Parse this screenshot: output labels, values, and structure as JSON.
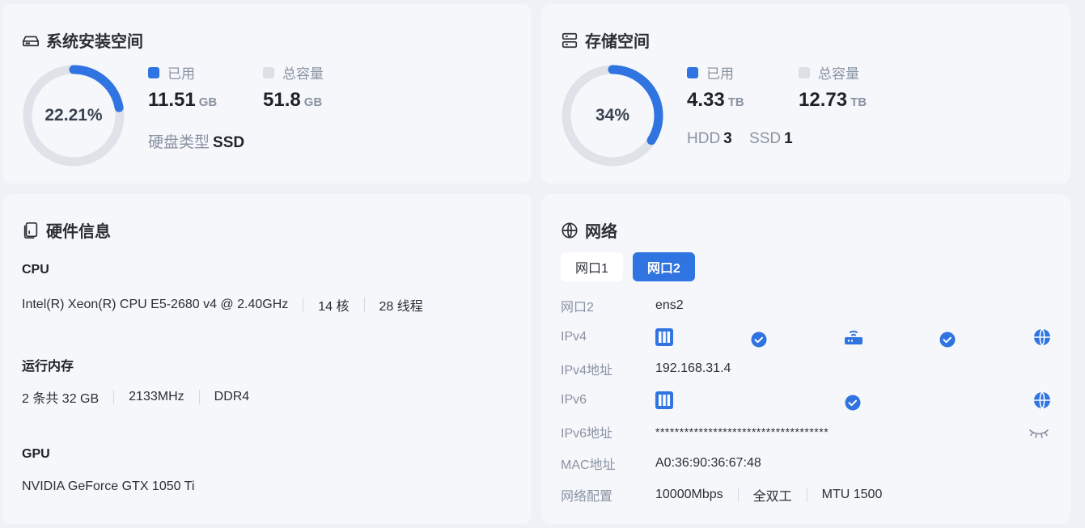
{
  "system_disk": {
    "title": "系统安装空间",
    "percent": 22.21,
    "percent_label": "22.21%",
    "used_label": "已用",
    "used_value": "11.51",
    "used_unit": "GB",
    "total_label": "总容量",
    "total_value": "51.8",
    "total_unit": "GB",
    "disk_type_label": "硬盘类型",
    "disk_type_value": "SSD"
  },
  "storage": {
    "title": "存储空间",
    "percent": 34,
    "percent_label": "34%",
    "used_label": "已用",
    "used_value": "4.33",
    "used_unit": "TB",
    "total_label": "总容量",
    "total_value": "12.73",
    "total_unit": "TB",
    "hdd_label": "HDD",
    "hdd_count": "3",
    "ssd_label": "SSD",
    "ssd_count": "1"
  },
  "hardware": {
    "title": "硬件信息",
    "cpu": {
      "label": "CPU",
      "model": "Intel(R) Xeon(R) CPU E5-2680 v4 @ 2.40GHz",
      "cores": "14 核",
      "threads": "28 线程"
    },
    "memory": {
      "label": "运行内存",
      "summary": "2 条共 32 GB",
      "speed": "2133MHz",
      "type": "DDR4"
    },
    "gpu": {
      "label": "GPU",
      "model": "NVIDIA GeForce GTX 1050 Ti"
    }
  },
  "network": {
    "title": "网络",
    "tabs": [
      {
        "label": "网口1"
      },
      {
        "label": "网口2"
      }
    ],
    "active_tab": 1,
    "rows": {
      "port": {
        "k": "网口2",
        "v": "ens2"
      },
      "ipv4": {
        "k": "IPv4"
      },
      "ipv4_addr": {
        "k": "IPv4地址",
        "v": "192.168.31.4"
      },
      "ipv6": {
        "k": "IPv6"
      },
      "ipv6_addr": {
        "k": "IPv6地址",
        "v": "************************************"
      },
      "mac": {
        "k": "MAC地址",
        "v": "A0:36:90:36:67:48"
      },
      "config": {
        "k": "网络配置",
        "speed": "10000Mbps",
        "duplex": "全双工",
        "mtu": "MTU 1500"
      }
    }
  },
  "colors": {
    "accent": "#2f74e0",
    "track": "#dfe2e8",
    "total_square": "#dcdfe5"
  },
  "icons": {
    "system_disk": "hard-drive-icon",
    "storage": "server-icon",
    "hardware": "device-icon",
    "network": "globe-icon",
    "nic": "nic-icon",
    "router": "router-icon",
    "check": "check-circle-icon",
    "eye": "eye-closed-icon"
  }
}
